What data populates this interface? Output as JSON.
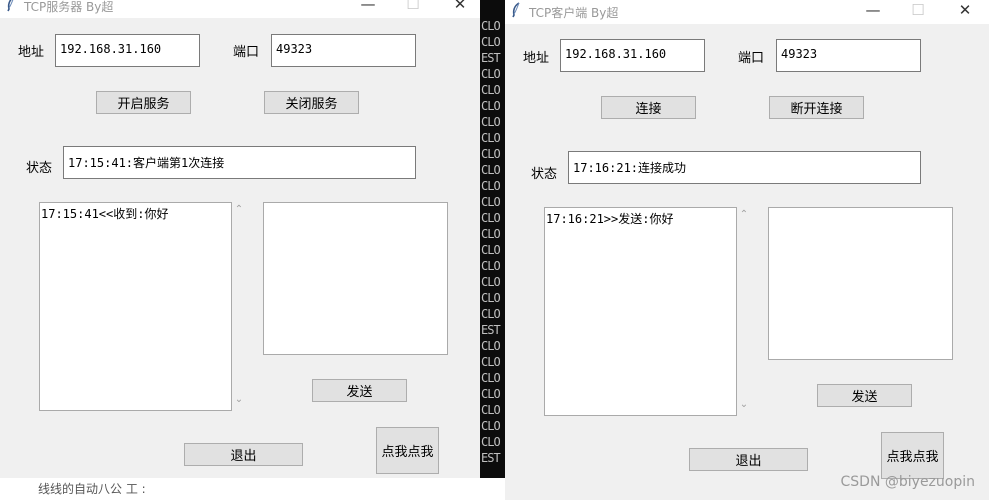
{
  "console": {
    "lines": [
      "CLO",
      "CLO",
      "EST",
      "CLO",
      "CLO",
      "CLO",
      "CLO",
      "CLO",
      "CLO",
      "CLO",
      "CLO",
      "CLO",
      "CLO",
      "CLO",
      "CLO",
      "CLO",
      "CLO",
      "CLO",
      "CLO",
      "EST",
      "CLO",
      "CLO",
      "CLO",
      "CLO",
      "CLO",
      "CLO",
      "CLO",
      "EST"
    ],
    "bottom_text": "线线的自动八公 工 :"
  },
  "server": {
    "title": "TCP服务器  By超",
    "minimize": "—",
    "maximize": "☐",
    "close": "✕",
    "address_label": "地址",
    "address_value": "192.168.31.160",
    "port_label": "端口",
    "port_value": "49323",
    "start_button": "开启服务",
    "stop_button": "关闭服务",
    "status_label": "状态",
    "status_value": "17:15:41:客户端第1次连接",
    "log_text": "17:15:41<<收到:你好",
    "message_text": "",
    "send_button": "发送",
    "exit_button": "退出",
    "click_button": "点我点我"
  },
  "client": {
    "title": "TCP客户端  By超",
    "minimize": "—",
    "maximize": "☐",
    "close": "✕",
    "address_label": "地址",
    "address_value": "192.168.31.160",
    "port_label": "端口",
    "port_value": "49323",
    "connect_button": "连接",
    "disconnect_button": "断开连接",
    "status_label": "状态",
    "status_value": "17:16:21:连接成功",
    "log_text": "17:16:21>>发送:你好",
    "message_text": "",
    "send_button": "发送",
    "exit_button": "退出",
    "click_button": "点我点我"
  },
  "scroll_up": "⌃",
  "scroll_down": "⌄",
  "watermark": "CSDN @biyezuopin"
}
